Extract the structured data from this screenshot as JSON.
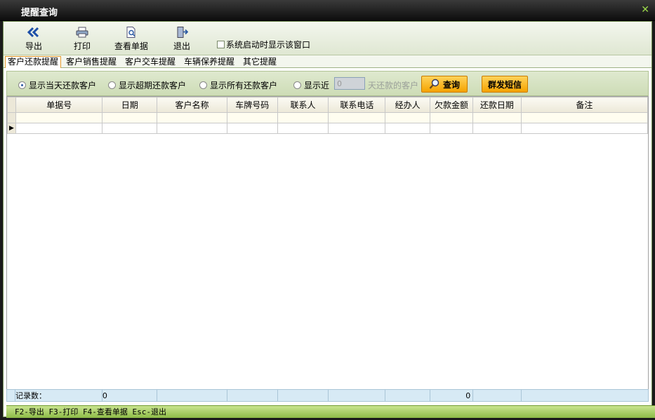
{
  "window": {
    "title": "提醒查询"
  },
  "toolbar": {
    "export_label": "导出",
    "print_label": "打印",
    "view_label": "查看单据",
    "exit_label": "退出",
    "startup_checkbox_label": "系统启动时显示该窗口"
  },
  "tabs": [
    {
      "label": "客户还款提醒"
    },
    {
      "label": "客户销售提醒"
    },
    {
      "label": "客户交车提醒"
    },
    {
      "label": "车辆保养提醒"
    },
    {
      "label": "其它提醒"
    }
  ],
  "filter": {
    "today_label": "显示当天还款客户",
    "overdue_label": "显示超期还款客户",
    "all_label": "显示所有还款客户",
    "recent_label": "显示近",
    "days_value": "0",
    "days_suffix": "天还款的客户",
    "query_label": "查询",
    "sms_label": "群发短信"
  },
  "table": {
    "columns": [
      "单据号",
      "日期",
      "客户名称",
      "车牌号码",
      "联系人",
      "联系电话",
      "经办人",
      "欠款金额",
      "还款日期",
      "备注"
    ]
  },
  "footer": {
    "record_label": "记录数：",
    "record_count": "0",
    "amount_total": "0"
  },
  "status": {
    "hint": "F2-导出 F3-打印 F4-查看单据 Esc-退出"
  },
  "colors": {
    "accent": "#f5a300",
    "status_bar": "#8dbb47",
    "title_bar": "#0d0d0d"
  }
}
